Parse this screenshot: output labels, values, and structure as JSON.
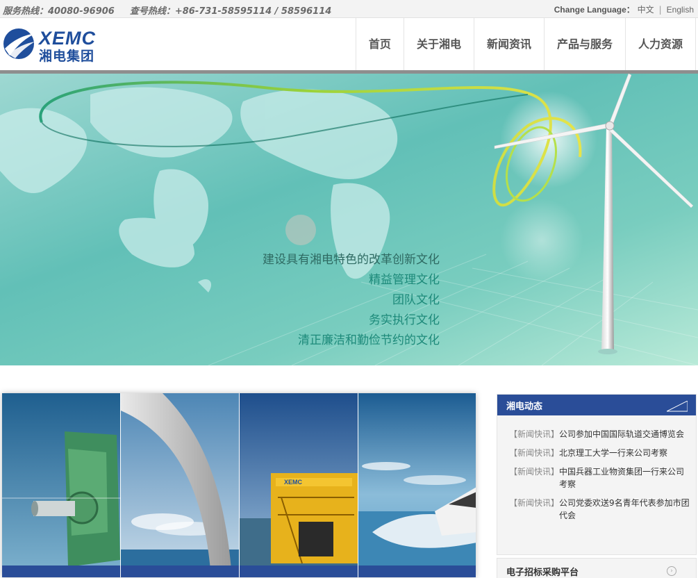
{
  "topbar": {
    "service_hotline": "服务热线：40080-96906",
    "query_hotline": "查号热线：+86-731-58595114 / 58596114",
    "change_language_label": "Change Language：",
    "lang_zh": "中文",
    "lang_sep": "|",
    "lang_en": "English"
  },
  "logo": {
    "en": "XEMC",
    "cn": "湘电集团"
  },
  "nav": {
    "items": [
      "首页",
      "关于湘电",
      "新闻资讯",
      "产品与服务",
      "人力资源"
    ]
  },
  "banner": {
    "slogans": [
      "建设具有湘电特色的改革创新文化",
      "精益管理文化",
      "团队文化",
      "务实执行文化",
      "清正廉洁和勤俭节约的文化"
    ]
  },
  "news": {
    "title": "湘电动态",
    "items": [
      {
        "tag": "【新闻快讯】",
        "text": "公司参加中国国际轨道交通博览会"
      },
      {
        "tag": "【新闻快讯】",
        "text": "北京理工大学一行来公司考察"
      },
      {
        "tag": "【新闻快讯】",
        "text": "中国兵器工业物资集团一行来公司考察"
      },
      {
        "tag": "【新闻快讯】",
        "text": "公司党委欢送9名青年代表参加市团代会"
      }
    ]
  },
  "bidding": {
    "label": "电子招标采购平台"
  },
  "gallery": {
    "truck_label": "XEMC"
  },
  "colors": {
    "brand_blue": "#2a4d98",
    "banner_teal": "#62c0b7",
    "slogan_green": "#1d8a7a"
  }
}
